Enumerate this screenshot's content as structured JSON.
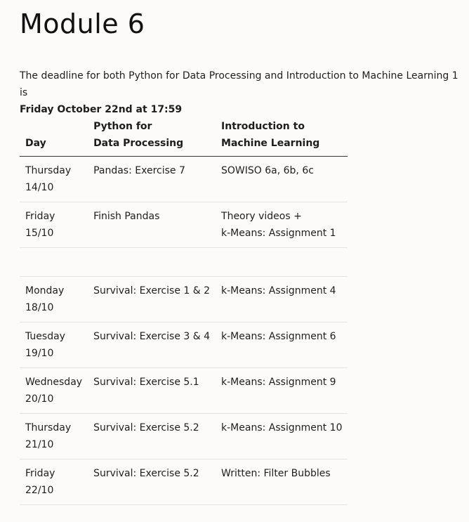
{
  "title": "Module 6",
  "intro": {
    "text": "The deadline for both Python for Data Processing and Introduction to Machine Learning 1 is",
    "deadline": "Friday October 22nd at 17:59"
  },
  "table": {
    "headers": {
      "day": [
        "Day"
      ],
      "python": [
        "Python for",
        "Data Processing"
      ],
      "ml": [
        "Introduction to",
        "Machine Learning"
      ]
    },
    "rows": [
      {
        "day": [
          "Thursday",
          "14/10"
        ],
        "python": [
          "Pandas: Exercise 7"
        ],
        "ml": [
          "SOWISO 6a, 6b, 6c"
        ]
      },
      {
        "day": [
          "Friday",
          "15/10"
        ],
        "python": [
          "Finish Pandas"
        ],
        "ml": [
          "Theory videos +",
          "k-Means: Assignment 1"
        ]
      },
      {
        "day": [],
        "python": [],
        "ml": [],
        "spacer": true
      },
      {
        "day": [
          "Monday",
          "18/10"
        ],
        "python": [
          "Survival: Exercise 1 & 2"
        ],
        "ml": [
          "k-Means: Assignment 4"
        ]
      },
      {
        "day": [
          "Tuesday",
          "19/10"
        ],
        "python": [
          "Survival: Exercise 3 & 4"
        ],
        "ml": [
          "k-Means: Assignment 6"
        ]
      },
      {
        "day": [
          "Wednesday",
          "20/10"
        ],
        "python": [
          "Survival: Exercise 5.1"
        ],
        "ml": [
          "k-Means: Assignment 9"
        ]
      },
      {
        "day": [
          "Thursday",
          "21/10"
        ],
        "python": [
          "Survival: Exercise 5.2"
        ],
        "ml": [
          "k-Means: Assignment 10"
        ]
      },
      {
        "day": [
          "Friday",
          "22/10"
        ],
        "python": [
          "Survival: Exercise 5.2"
        ],
        "ml": [
          "Written: Filter Bubbles"
        ]
      }
    ]
  }
}
